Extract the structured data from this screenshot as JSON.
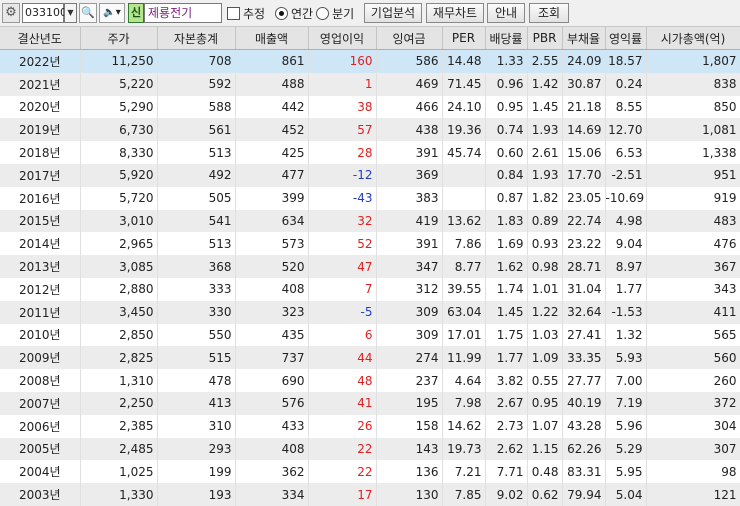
{
  "toolbar": {
    "code": "033100",
    "badge": "신",
    "name": "제룡전기",
    "estimate_label": "추정",
    "annual_label": "연간",
    "quarter_label": "분기",
    "buttons": [
      "기업분석",
      "재무차트",
      "안내",
      "조회"
    ]
  },
  "columns": [
    "결산년도",
    "주가",
    "자본총계",
    "매출액",
    "영업이익",
    "잉여금",
    "PER",
    "배당률",
    "PBR",
    "부채율",
    "영익률",
    "시가총액(억)"
  ],
  "rows": [
    {
      "year": "2022년",
      "price": "11,250",
      "equity": "708",
      "sales": "861",
      "op": "160",
      "op_sign": "pos",
      "surplus": "586",
      "per": "14.48",
      "div": "1.33",
      "pbr": "2.55",
      "debt": "24.09",
      "opm": "18.57",
      "mcap": "1,807"
    },
    {
      "year": "2021년",
      "price": "5,220",
      "equity": "592",
      "sales": "488",
      "op": "1",
      "op_sign": "pos",
      "surplus": "469",
      "per": "71.45",
      "div": "0.96",
      "pbr": "1.42",
      "debt": "30.87",
      "opm": "0.24",
      "mcap": "838"
    },
    {
      "year": "2020년",
      "price": "5,290",
      "equity": "588",
      "sales": "442",
      "op": "38",
      "op_sign": "pos",
      "surplus": "466",
      "per": "24.10",
      "div": "0.95",
      "pbr": "1.45",
      "debt": "21.18",
      "opm": "8.55",
      "mcap": "850"
    },
    {
      "year": "2019년",
      "price": "6,730",
      "equity": "561",
      "sales": "452",
      "op": "57",
      "op_sign": "pos",
      "surplus": "438",
      "per": "19.36",
      "div": "0.74",
      "pbr": "1.93",
      "debt": "14.69",
      "opm": "12.70",
      "mcap": "1,081"
    },
    {
      "year": "2018년",
      "price": "8,330",
      "equity": "513",
      "sales": "425",
      "op": "28",
      "op_sign": "pos",
      "surplus": "391",
      "per": "45.74",
      "div": "0.60",
      "pbr": "2.61",
      "debt": "15.06",
      "opm": "6.53",
      "mcap": "1,338"
    },
    {
      "year": "2017년",
      "price": "5,920",
      "equity": "492",
      "sales": "477",
      "op": "-12",
      "op_sign": "neg",
      "surplus": "369",
      "per": "",
      "div": "0.84",
      "pbr": "1.93",
      "debt": "17.70",
      "opm": "-2.51",
      "mcap": "951"
    },
    {
      "year": "2016년",
      "price": "5,720",
      "equity": "505",
      "sales": "399",
      "op": "-43",
      "op_sign": "neg",
      "surplus": "383",
      "per": "",
      "div": "0.87",
      "pbr": "1.82",
      "debt": "23.05",
      "opm": "-10.69",
      "mcap": "919"
    },
    {
      "year": "2015년",
      "price": "3,010",
      "equity": "541",
      "sales": "634",
      "op": "32",
      "op_sign": "pos",
      "surplus": "419",
      "per": "13.62",
      "div": "1.83",
      "pbr": "0.89",
      "debt": "22.74",
      "opm": "4.98",
      "mcap": "483"
    },
    {
      "year": "2014년",
      "price": "2,965",
      "equity": "513",
      "sales": "573",
      "op": "52",
      "op_sign": "pos",
      "surplus": "391",
      "per": "7.86",
      "div": "1.69",
      "pbr": "0.93",
      "debt": "23.22",
      "opm": "9.04",
      "mcap": "476"
    },
    {
      "year": "2013년",
      "price": "3,085",
      "equity": "368",
      "sales": "520",
      "op": "47",
      "op_sign": "pos",
      "surplus": "347",
      "per": "8.77",
      "div": "1.62",
      "pbr": "0.98",
      "debt": "28.71",
      "opm": "8.97",
      "mcap": "367"
    },
    {
      "year": "2012년",
      "price": "2,880",
      "equity": "333",
      "sales": "408",
      "op": "7",
      "op_sign": "pos",
      "surplus": "312",
      "per": "39.55",
      "div": "1.74",
      "pbr": "1.01",
      "debt": "31.04",
      "opm": "1.77",
      "mcap": "343"
    },
    {
      "year": "2011년",
      "price": "3,450",
      "equity": "330",
      "sales": "323",
      "op": "-5",
      "op_sign": "neg",
      "surplus": "309",
      "per": "63.04",
      "div": "1.45",
      "pbr": "1.22",
      "debt": "32.64",
      "opm": "-1.53",
      "mcap": "411"
    },
    {
      "year": "2010년",
      "price": "2,850",
      "equity": "550",
      "sales": "435",
      "op": "6",
      "op_sign": "pos",
      "surplus": "309",
      "per": "17.01",
      "div": "1.75",
      "pbr": "1.03",
      "debt": "27.41",
      "opm": "1.32",
      "mcap": "565"
    },
    {
      "year": "2009년",
      "price": "2,825",
      "equity": "515",
      "sales": "737",
      "op": "44",
      "op_sign": "pos",
      "surplus": "274",
      "per": "11.99",
      "div": "1.77",
      "pbr": "1.09",
      "debt": "33.35",
      "opm": "5.93",
      "mcap": "560"
    },
    {
      "year": "2008년",
      "price": "1,310",
      "equity": "478",
      "sales": "690",
      "op": "48",
      "op_sign": "pos",
      "surplus": "237",
      "per": "4.64",
      "div": "3.82",
      "pbr": "0.55",
      "debt": "27.77",
      "opm": "7.00",
      "mcap": "260"
    },
    {
      "year": "2007년",
      "price": "2,250",
      "equity": "413",
      "sales": "576",
      "op": "41",
      "op_sign": "pos",
      "surplus": "195",
      "per": "7.98",
      "div": "2.67",
      "pbr": "0.95",
      "debt": "40.19",
      "opm": "7.19",
      "mcap": "372"
    },
    {
      "year": "2006년",
      "price": "2,385",
      "equity": "310",
      "sales": "433",
      "op": "26",
      "op_sign": "pos",
      "surplus": "158",
      "per": "14.62",
      "div": "2.73",
      "pbr": "1.07",
      "debt": "43.28",
      "opm": "5.96",
      "mcap": "304"
    },
    {
      "year": "2005년",
      "price": "2,485",
      "equity": "293",
      "sales": "408",
      "op": "22",
      "op_sign": "pos",
      "surplus": "143",
      "per": "19.73",
      "div": "2.62",
      "pbr": "1.15",
      "debt": "62.26",
      "opm": "5.29",
      "mcap": "307"
    },
    {
      "year": "2004년",
      "price": "1,025",
      "equity": "199",
      "sales": "362",
      "op": "22",
      "op_sign": "pos",
      "surplus": "136",
      "per": "7.21",
      "div": "7.71",
      "pbr": "0.48",
      "debt": "83.31",
      "opm": "5.95",
      "mcap": "98"
    },
    {
      "year": "2003년",
      "price": "1,330",
      "equity": "193",
      "sales": "334",
      "op": "17",
      "op_sign": "pos",
      "surplus": "130",
      "per": "7.85",
      "div": "9.02",
      "pbr": "0.62",
      "debt": "79.94",
      "opm": "5.04",
      "mcap": "121"
    }
  ]
}
